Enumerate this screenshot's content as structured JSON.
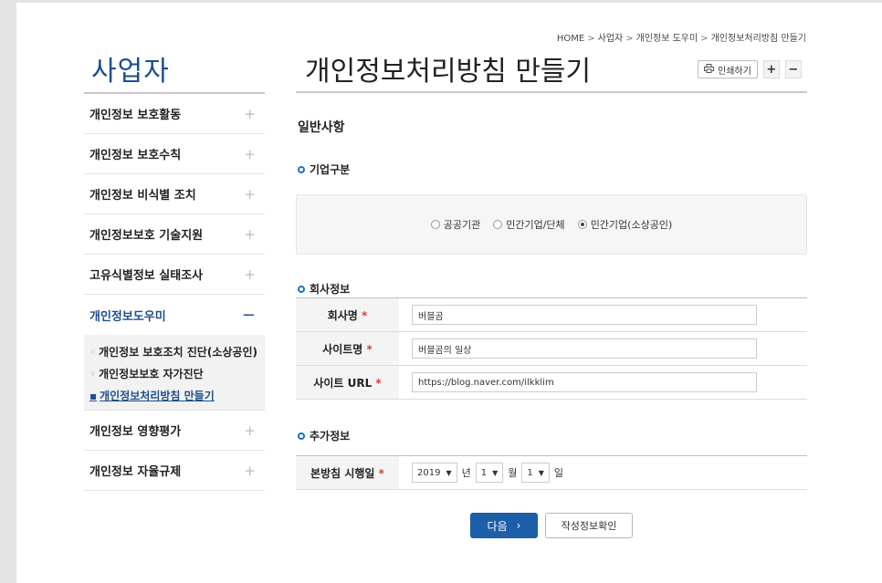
{
  "breadcrumb": [
    "HOME",
    "사업자",
    "개인정보 도우미",
    "개인정보처리방침 만들기"
  ],
  "sidebar": {
    "title": "사업자",
    "items": [
      {
        "label": "개인정보 보호활동",
        "icon": "+"
      },
      {
        "label": "개인정보 보호수칙",
        "icon": "+"
      },
      {
        "label": "개인정보 비식별 조치",
        "icon": "+"
      },
      {
        "label": "개인정보보호 기술지원",
        "icon": "+"
      },
      {
        "label": "고유식별정보 실태조사",
        "icon": "+"
      },
      {
        "label": "개인정보도우미",
        "icon": "−"
      },
      {
        "label": "개인정보 영향평가",
        "icon": "+"
      },
      {
        "label": "개인정보 자율규제",
        "icon": "+"
      }
    ],
    "sub_items": [
      {
        "label": "개인정보 보호조치 진단(소상공인)",
        "bullet": "◦"
      },
      {
        "label": "개인정보보호 자가진단",
        "bullet": "◦"
      },
      {
        "label": "개인정보처리방침 만들기",
        "bullet": "▪"
      }
    ]
  },
  "main": {
    "title": "개인정보처리방침 만들기",
    "print_label": "인쇄하기",
    "zoom_in": "+",
    "zoom_out": "−",
    "section_title": "일반사항",
    "company_type": {
      "heading": "기업구분",
      "options": [
        "공공기관",
        "민간기업/단체",
        "민간기업(소상공인)"
      ],
      "selected": "민간기업(소상공인)"
    },
    "company_info": {
      "heading": "회사정보",
      "required_mark": "*",
      "fields": [
        {
          "label": "회사명",
          "value": "버블곰"
        },
        {
          "label": "사이트명",
          "value": "버블곰의 일상"
        },
        {
          "label": "사이트 URL",
          "value": "https://blog.naver.com/ilkklim"
        }
      ]
    },
    "extra_info": {
      "heading": "추가정보",
      "date_label": "본방침 시행일",
      "year": "2019",
      "year_unit": "년",
      "month": "1",
      "month_unit": "월",
      "day": "1",
      "day_unit": "일"
    },
    "next_label": "다음",
    "next_arrow": "›",
    "check_label": "작성정보확인"
  }
}
